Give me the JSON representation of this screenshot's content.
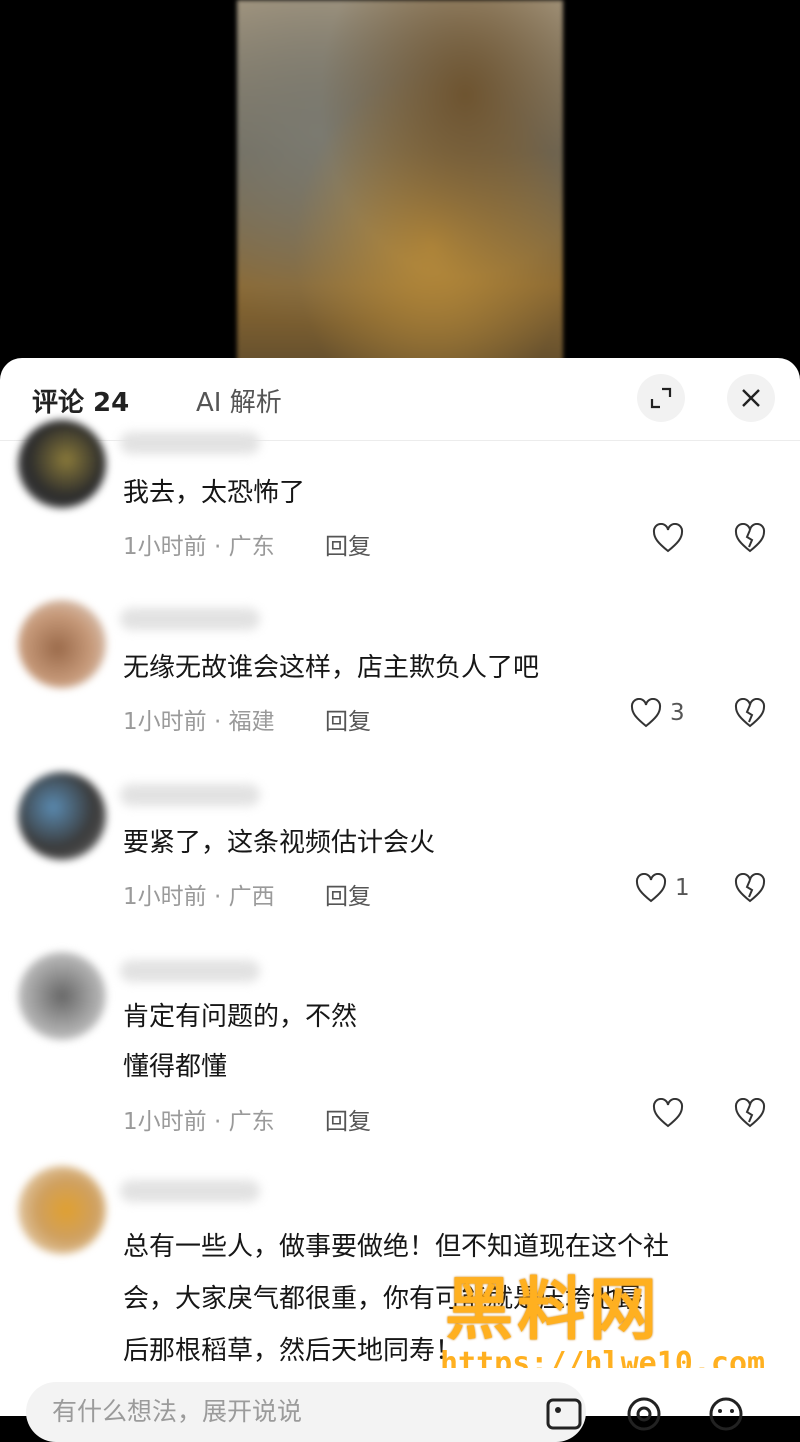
{
  "header": {
    "tab_comments": "评论 24",
    "tab_ai": "AI 解析"
  },
  "comments": [
    {
      "text": "我去，太恐怖了",
      "meta": "1小时前 · 广东",
      "reply": "回复",
      "likes": ""
    },
    {
      "text": "无缘无故谁会这样，店主欺负人了吧",
      "meta": "1小时前 · 福建",
      "reply": "回复",
      "likes": "3"
    },
    {
      "text": "要紧了，这条视频估计会火",
      "meta": "1小时前 · 广西",
      "reply": "回复",
      "likes": "1"
    },
    {
      "text_line1": "肯定有问题的，不然",
      "text_line2": "懂得都懂",
      "meta": "1小时前 · 广东",
      "reply": "回复",
      "likes": ""
    },
    {
      "text_line1": "总有一些人，做事要做绝！但不知道现在这个社",
      "text_line2": "会，大家戾气都很重，你有可能就是压垮他最",
      "text_line3": "后那根稻草，然后天地同寿！"
    }
  ],
  "input": {
    "placeholder": "有什么想法，展开说说"
  },
  "watermark": {
    "brand": "黑料网",
    "url": "https://hlwe10.com"
  },
  "colors": {
    "accent_watermark": "#ffb020"
  }
}
